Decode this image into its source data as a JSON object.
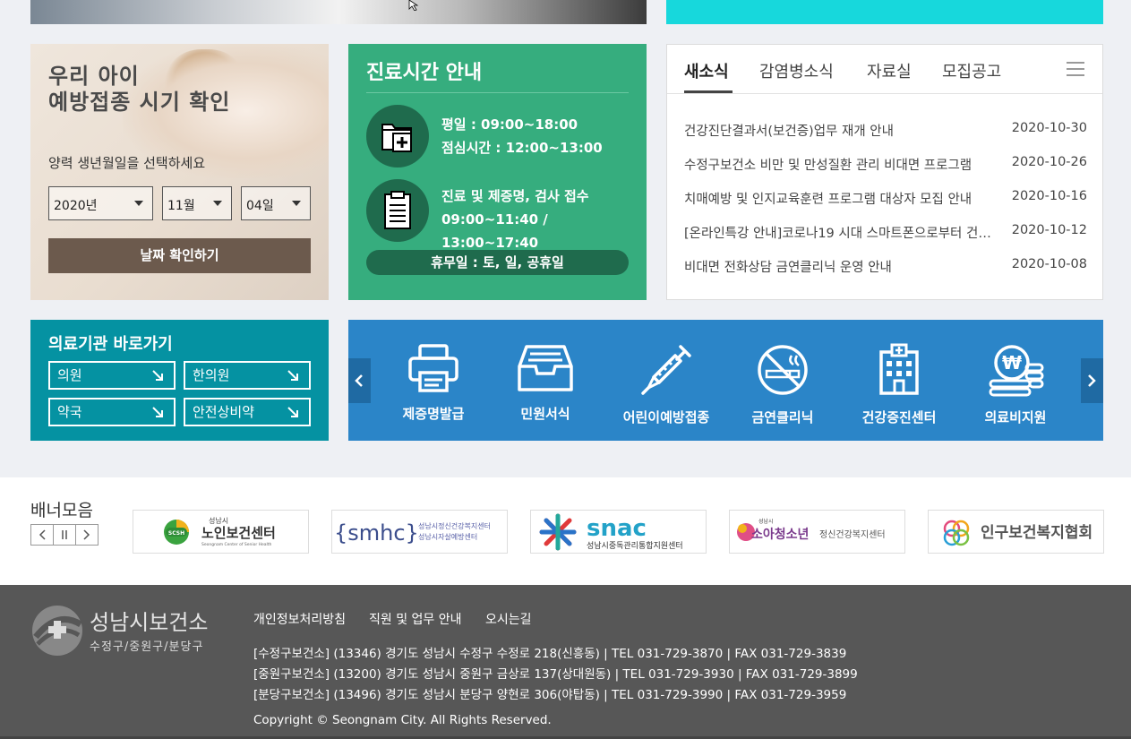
{
  "vaccine": {
    "title_line1": "우리 아이",
    "title_line2": "예방접종 시기 확인",
    "subtitle": "양력 생년월일을 선택하세요",
    "year": "2020년",
    "month": "11월",
    "day": "04일",
    "button": "날짜 확인하기"
  },
  "hours": {
    "title": "진료시간 안내",
    "weekday": "평일 : 09:00~18:00",
    "lunch": "점심시간 : 12:00~13:00",
    "reception_title": "진료 및 제증명, 검사 접수",
    "reception_time": "09:00~11:40 / 13:00~17:40",
    "closed": "휴무일 : 토, 일, 공휴일"
  },
  "news": {
    "tabs": [
      "새소식",
      "감염병소식",
      "자료실",
      "모집공고"
    ],
    "items": [
      {
        "title": "건강진단결과서(보건증)업무 재개 안내",
        "date": "2020-10-30"
      },
      {
        "title": "수정구보건소 비만 및 만성질환 관리 비대면 프로그램",
        "date": "2020-10-26"
      },
      {
        "title": "치매예방 및 인지교육훈련 프로그램 대상자 모집 안내",
        "date": "2020-10-16"
      },
      {
        "title": "[온라인특강 안내]코로나19 시대 스마트폰으로부터 건강지키기",
        "date": "2020-10-12"
      },
      {
        "title": "비대면 전화상담 금연클리닉 운영 안내",
        "date": "2020-10-08"
      }
    ]
  },
  "quick": {
    "title": "의료기관 바로가기",
    "links": [
      "의원",
      "한의원",
      "약국",
      "안전상비약"
    ]
  },
  "services": [
    {
      "label": "제증명발급",
      "icon": "printer-icon"
    },
    {
      "label": "민원서식",
      "icon": "inbox-icon"
    },
    {
      "label": "어린이예방접종",
      "icon": "syringe-icon"
    },
    {
      "label": "금연클리닉",
      "icon": "no-smoking-icon"
    },
    {
      "label": "건강증진센터",
      "icon": "hospital-icon"
    },
    {
      "label": "의료비지원",
      "icon": "coins-icon"
    }
  ],
  "banner": {
    "title": "배너모음",
    "logos": [
      {
        "top": "성남시",
        "main": "노인보건센터",
        "sub": "Seongnam Center of Senior Health",
        "mark": "SCSH"
      },
      {
        "main": "{smhc}",
        "sub1": "성남시정신건강복지센터",
        "sub2": "성남시자살예방센터"
      },
      {
        "main": "snac",
        "sub": "성남시중독관리통합지원센터"
      },
      {
        "top": "성남시",
        "main": "소아청소년",
        "sub": "정신건강복지센터"
      },
      {
        "main": "인구보건복지협회"
      }
    ]
  },
  "footer": {
    "org": "성남시보건소",
    "org_sub": "수정구/중원구/분당구",
    "links": [
      "개인정보처리방침",
      "직원 및 업무 안내",
      "오시는길"
    ],
    "addresses": [
      "[수정구보건소] (13346) 경기도 성남시 수정구 수정로 218(신흥동) | TEL 031-729-3870 | FAX 031-729-3839",
      "[중원구보건소] (13200) 경기도 성남시 중원구 금상로 137(상대원동) | TEL 031-729-3930 | FAX 031-729-3899",
      "[분당구보건소] (13496) 경기도 성남시 분당구 양현로 306(야탑동) | TEL 031-729-3990 | FAX 031-729-3959"
    ],
    "copyright": "Copyright © Seongnam City. All Rights Reserved."
  },
  "colors": {
    "hours_green": "#36ad7e",
    "quick_teal": "#0592a2",
    "service_blue": "#2b85c8",
    "footer_gray": "#575757",
    "vaccine_button": "#6c5a4d"
  }
}
